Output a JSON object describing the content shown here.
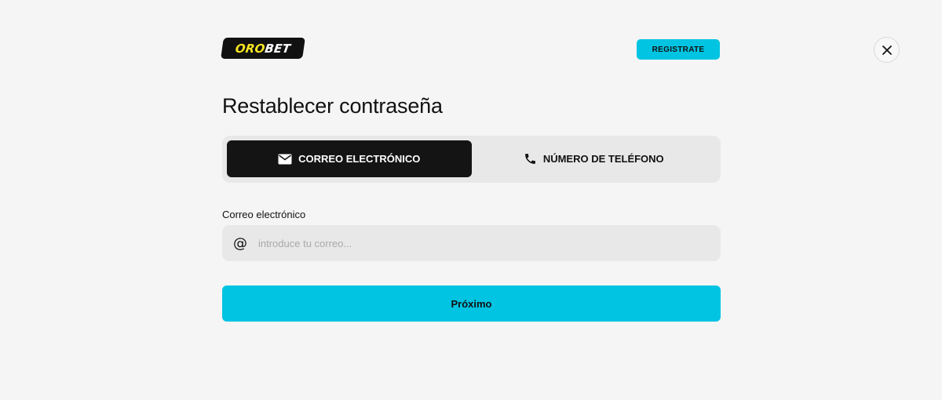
{
  "header": {
    "logo": {
      "part1": "ORO",
      "part2": "BET"
    },
    "register_label": "REGISTRATE",
    "close_icon": "close-icon"
  },
  "title": "Restablecer contraseña",
  "tabs": [
    {
      "label": "CORREO ELECTRÓNICO",
      "icon": "mail-icon",
      "active": true
    },
    {
      "label": "NÚMERO DE TELÉFONO",
      "icon": "phone-icon",
      "active": false
    }
  ],
  "email_field": {
    "label": "Correo electrónico",
    "placeholder": "introduce tu correo...",
    "value": "",
    "icon": "at-icon"
  },
  "submit_label": "Próximo",
  "colors": {
    "accent": "#00c4e2",
    "logo_yellow": "#f6e521",
    "dark": "#141414",
    "background": "#f5f5f5",
    "field_bg": "#e8e8e8"
  }
}
